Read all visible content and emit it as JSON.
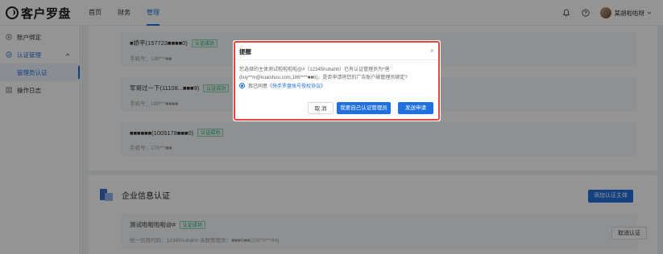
{
  "app": {
    "logo_text": "客户罗盘"
  },
  "nav": {
    "items": [
      "首页",
      "财务",
      "管理"
    ],
    "active": "管理"
  },
  "user": {
    "name": "某胡啦啦呀"
  },
  "sidebar": {
    "item_account_binding": "账户绑定",
    "item_auth_management": "认证管理",
    "sub_admin_auth": "管理员认证",
    "item_operation_log": "操作日志"
  },
  "admin_cards": [
    {
      "name": "■娇平(157723■■■■0)",
      "badge": "认证成功",
      "phone": "手机号：138***■■"
    },
    {
      "name": "军哥过一下(11108...■■■9)",
      "badge": "认证成功",
      "phone": "手机号：188***■■■■"
    },
    {
      "name": "■■■■■■(1005178■■■0)",
      "badge": "认证成功",
      "phone": "手机号：178***■■"
    }
  ],
  "enterprise": {
    "title": "企业信息认证",
    "add_button": "添加认证主体",
    "entity_name": "测试啦啦啦啦@#",
    "entity_badge": "认证成功",
    "entity_meta": "统一信用代码：12345huhahh   关联管理员：■■■6■■(230*0***84)",
    "cancel_button": "取消认证"
  },
  "modal": {
    "title": "提醒",
    "close_glyph": "×",
    "message": "您选择的主体测试啦啦啦啦@#（12345huhahh）已有认证管理员为*爸(liuy**m@kuaishou.com,186****■■6)，是否申请将您的广告账户被管理员绑定?",
    "agree_prefix": "我已同意",
    "agree_link": "《快手罗盘账号授权协议》",
    "btn_cancel": "取 消",
    "btn_self_admin": "我要自己认证管理员",
    "btn_send": "发送申请"
  }
}
